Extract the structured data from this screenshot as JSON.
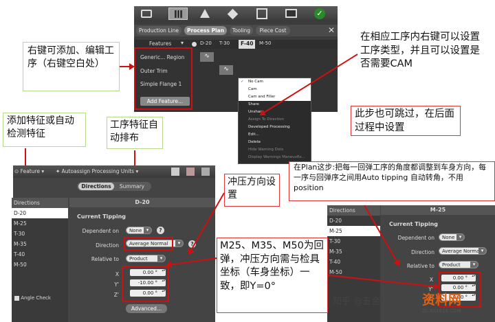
{
  "top_panel": {
    "tabs": [
      "Production Line",
      "Process Plan",
      "Tooling",
      "Piece Cost"
    ],
    "features_label": "Features",
    "columns": [
      "D-20",
      "T-30",
      "F-40",
      "M-50"
    ],
    "features": [
      "Generic... Region",
      "Outer Trim",
      "Simple Flange 1"
    ],
    "add_feature": "Add Feature...",
    "context_menu": [
      "No Cam",
      "Cam",
      "Cam and Filler",
      "Share",
      "Unshare",
      "Assign To Direction",
      "Developed Processing",
      "Edit...",
      "Delete",
      "Hide Warning Dots",
      "Display Warnings ManeuvRs..."
    ]
  },
  "middle_panel": {
    "feature_label": "Feature",
    "autoassign_label": "Autoassign Processing Units",
    "tabs": [
      "Directions",
      "Summary"
    ],
    "list_header": "Directions",
    "directions": [
      "D-20",
      "M-25",
      "T-30",
      "M-35",
      "T-40",
      "M-50"
    ],
    "angle_check": "Angle Check",
    "title": "D-20",
    "section": "Current Tipping",
    "labels": {
      "dependent": "Dependent on",
      "direction": "Direction",
      "relative": "Relative to",
      "x": "X",
      "y": "Y'",
      "z": "Z'"
    },
    "values": {
      "dependent": "None",
      "direction": "Average Normal",
      "relative": "Product",
      "x": "0.00 °",
      "y": "-10.00 °",
      "z": "0.00 °"
    },
    "advanced": "Advanced..."
  },
  "right_panel": {
    "list_header": "Directions",
    "directions": [
      "D-20",
      "M-25",
      "T-30",
      "M-35",
      "T-40",
      "M-50"
    ],
    "title": "M-25",
    "section": "Current Tipping",
    "labels": {
      "dependent": "Dependent on",
      "direction": "Direction",
      "relative": "Relative to",
      "x": "X",
      "y": "Y'",
      "z": "Z'"
    },
    "values": {
      "dependent": "None",
      "direction": "Average Normal",
      "relative": "Product",
      "x": "0.00 °",
      "y": "0.00 °",
      "z": "0.00 °"
    }
  },
  "notes": {
    "n1": "右键可添加、编辑工序（右键空白处）",
    "n2": "在相应工序内右键可以设置工序类型，并且可以设置是否需要CAM",
    "n3": "此步也可跳过，在后面过程中设置",
    "n4": "添加特征或自动检测特征",
    "n5": "工序特征自动排布",
    "n6": "冲压方向设置",
    "n7": "在Plan这步:把每一回弹工序的角度都调整到车身方向，每一序与回弹序之间用Auto tipping 自动转角，不用position",
    "n8": "M25、M35、M50为回弹，冲压方向需与检具坐标（车身坐标）一致，即Y=0°"
  },
  "watermark": "知乎 @五金模具设计",
  "logo": "资料网",
  "site": "ZL.XS1616.COM"
}
